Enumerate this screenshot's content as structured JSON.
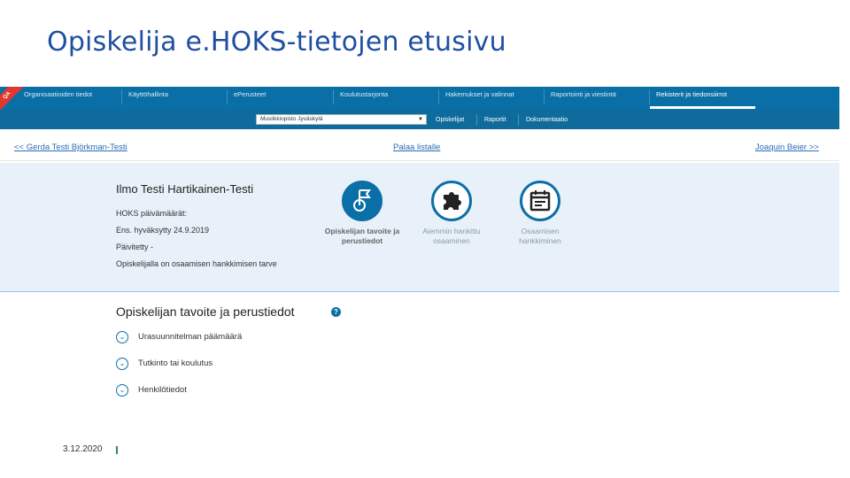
{
  "slide": {
    "title": "Opiskelija e.HOKS-tietojen etusivu",
    "date": "3.12.2020"
  },
  "app": {
    "ribbon": "QA",
    "nav": [
      "Organisaatioiden tiedot",
      "Käyttöhallinta",
      "ePerusteet",
      "Koulutustarjonta",
      "Hakemukset ja valinnat",
      "Raportointi ja viestintä",
      "Rekisterit ja tiedonsiirrot"
    ],
    "org_select": "Musiikkiopisto Jyväskylä",
    "subnav": [
      "Opiskelijat",
      "Raportit",
      "Dokumentaatio"
    ],
    "pager": {
      "prev": "<< Gerda Testi Björkman-Testi",
      "back": "Palaa listalle",
      "next": "Joaquin Beier >>"
    },
    "student": {
      "name": "Ilmo Testi Hartikainen-Testi",
      "dates_heading": "HOKS päivämäärät:",
      "approved": "Ens. hyväksytty  24.9.2019",
      "updated": "Päivitetty  -",
      "need": "Opiskelijalla on osaamisen hankkimisen tarve"
    },
    "steps": [
      {
        "line1": "Opiskelijan tavoite ja",
        "line2": "perustiedot",
        "icon": "flag-icon",
        "active": true
      },
      {
        "line1": "Aiemmin hankittu",
        "line2": "osaaminen",
        "icon": "puzzle-icon",
        "active": false
      },
      {
        "line1": "Osaamisen",
        "line2": "hankkiminen",
        "icon": "calendar-icon",
        "active": false
      }
    ],
    "section": {
      "title": "Opiskelijan tavoite ja perustiedot",
      "help": "?",
      "items": [
        "Urasuunnitelman päämäärä",
        "Tutkinto tai koulutus",
        "Henkilötiedot"
      ]
    }
  },
  "colors": {
    "title": "#1f4fa0",
    "nav_bg": "#0b6fa7",
    "panel_bg": "#e8f1f9",
    "link": "#2a6db5"
  }
}
